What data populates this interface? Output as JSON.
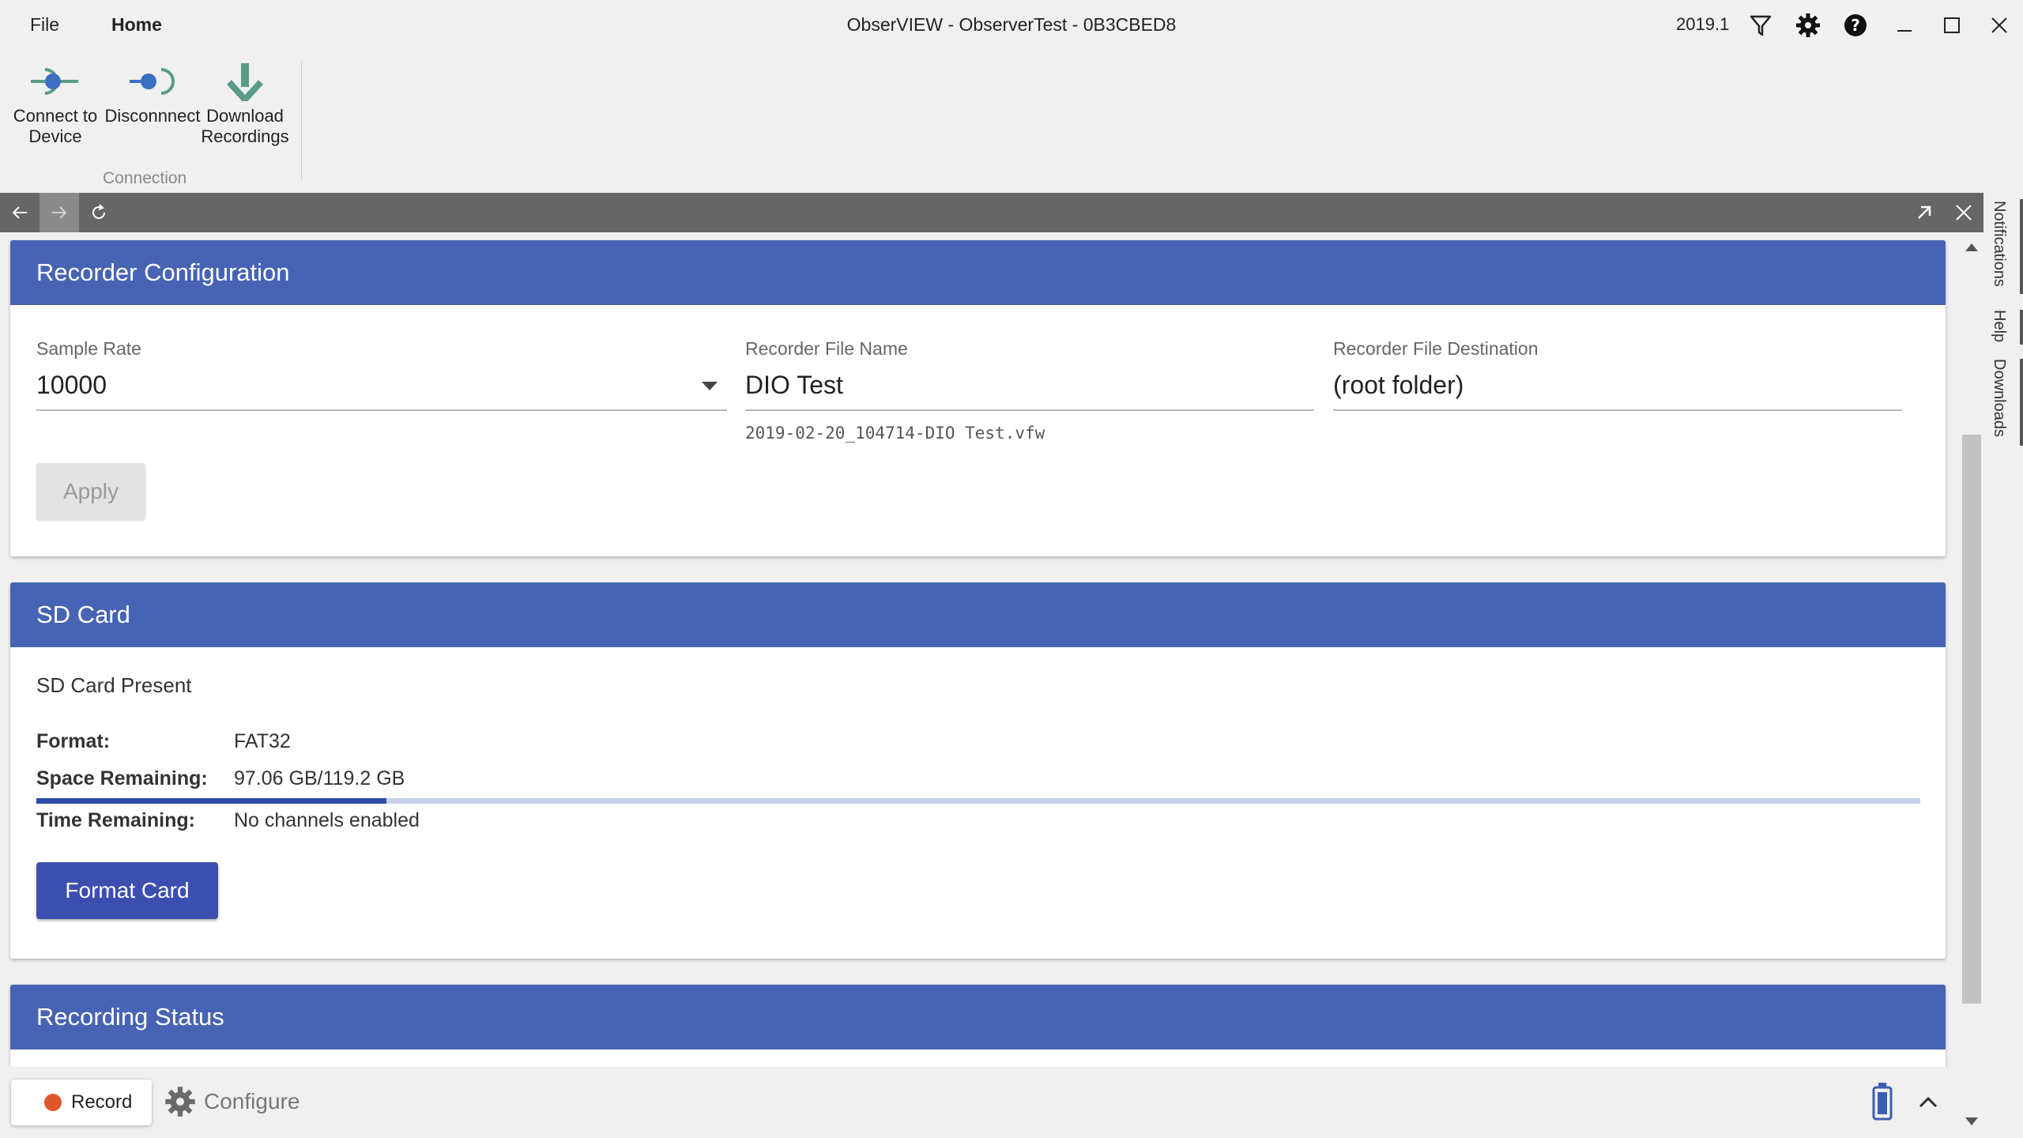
{
  "menu": {
    "file": "File",
    "home": "Home"
  },
  "window": {
    "title": "ObserVIEW - ObserverTest - 0B3CBED8",
    "version": "2019.1"
  },
  "ribbon": {
    "connect_label": "Connect to Device",
    "disconnect_label": "Disconnnect",
    "download_label": "Download Recordings",
    "group_label": "Connection"
  },
  "side_tabs": {
    "notifications": "Notifications",
    "help": "Help",
    "downloads": "Downloads"
  },
  "recorder_config": {
    "title": "Recorder Configuration",
    "sample_rate_label": "Sample Rate",
    "sample_rate_value": "10000",
    "file_name_label": "Recorder File Name",
    "file_name_value": "DIO Test",
    "file_name_hint": "2019-02-20_104714-DIO Test.vfw",
    "destination_label": "Recorder File Destination",
    "destination_value": "(root folder)",
    "apply_label": "Apply"
  },
  "sd_card": {
    "title": "SD Card",
    "status": "SD Card Present",
    "format_key": "Format:",
    "format_value": "FAT32",
    "space_key": "Space Remaining:",
    "space_value": "97.06 GB/119.2 GB",
    "space_used_fraction": 0.186,
    "time_key": "Time Remaining:",
    "time_value": "No channels enabled",
    "format_button": "Format Card"
  },
  "recording_status": {
    "title": "Recording Status"
  },
  "bottom": {
    "record_label": "Record",
    "configure_label": "Configure"
  },
  "colors": {
    "header_blue": "#4763b4",
    "button_blue": "#3c4fb0",
    "record_orange": "#e0572a",
    "ribbon_teal": "#5a9a8a"
  }
}
